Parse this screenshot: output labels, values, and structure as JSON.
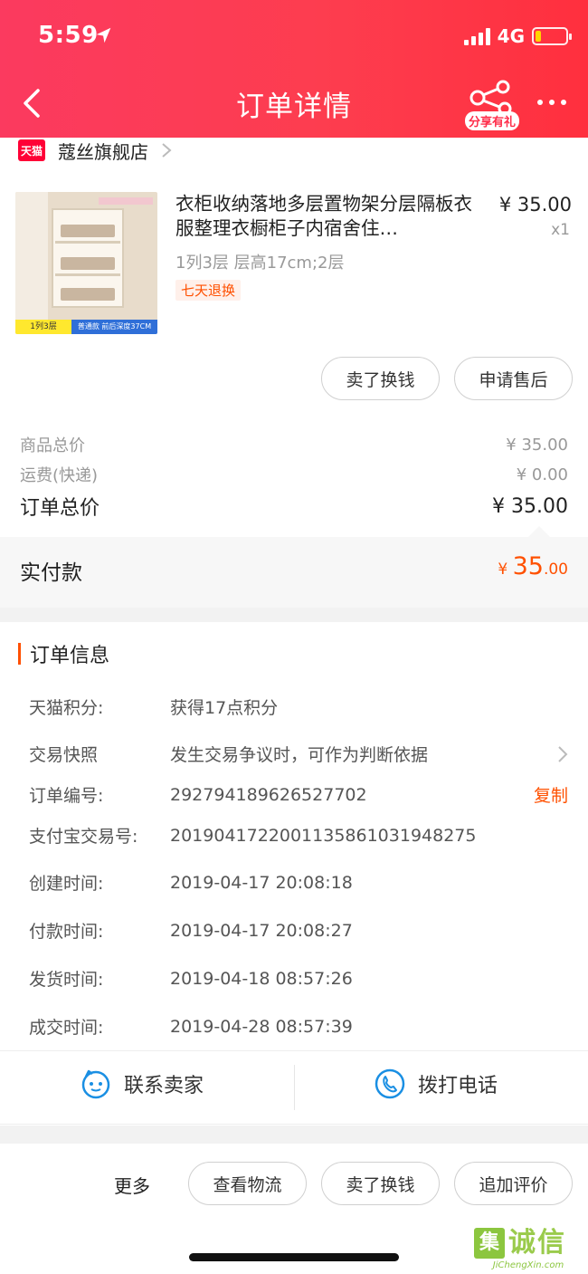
{
  "status": {
    "time": "5:59",
    "network": "4G"
  },
  "header": {
    "title": "订单详情",
    "share_badge": "分享有礼"
  },
  "shop": {
    "logo_text": "天猫",
    "name": "蔻丝旗舰店"
  },
  "product": {
    "title": "衣柜收纳落地多层置物架分层隔板衣服整理衣橱柜子内宿舍住…",
    "price": "¥ 35.00",
    "qty": "x1",
    "sku": "1列3层 层高17cm;2层",
    "badge": "七天退换",
    "thumb_tag1": "1列3层",
    "thumb_tag2": "普通款 前后深度37CM"
  },
  "product_actions": {
    "sell": "卖了换钱",
    "aftersale": "申请售后"
  },
  "summary": {
    "goods_label": "商品总价",
    "goods_value": "¥ 35.00",
    "shipping_label": "运费(快递)",
    "shipping_value": "¥ 0.00",
    "total_label": "订单总价",
    "total_value": "¥ 35.00",
    "paid_label": "实付款",
    "paid_currency": "¥ ",
    "paid_int": "35",
    "paid_dec": ".00"
  },
  "order_info": {
    "title": "订单信息",
    "rows": [
      {
        "label": "天猫积分:",
        "value": "获得17点积分"
      },
      {
        "label": "交易快照",
        "value": "发生交易争议时，可作为判断依据"
      },
      {
        "label": "订单编号:",
        "value": "292794189626527702"
      },
      {
        "label": "支付宝交易号:",
        "value": "2019041722001135861031948275"
      },
      {
        "label": "创建时间:",
        "value": "2019-04-17 20:08:18"
      },
      {
        "label": "付款时间:",
        "value": "2019-04-17 20:08:27"
      },
      {
        "label": "发货时间:",
        "value": "2019-04-18 08:57:26"
      },
      {
        "label": "成交时间:",
        "value": "2019-04-28 08:57:39"
      }
    ],
    "copy_label": "复制"
  },
  "contact": {
    "seller": "联系卖家",
    "call": "拨打电话"
  },
  "bottom": {
    "more": "更多",
    "logistics": "查看物流",
    "sell": "卖了换钱",
    "review": "追加评价"
  },
  "watermark": {
    "char": "集",
    "text": "诚信",
    "sub": "JiChengXin.com"
  },
  "colors": {
    "header_red": "#fd3d4f",
    "accent_orange": "#ff5000",
    "contact_blue": "#1a8fe3"
  }
}
